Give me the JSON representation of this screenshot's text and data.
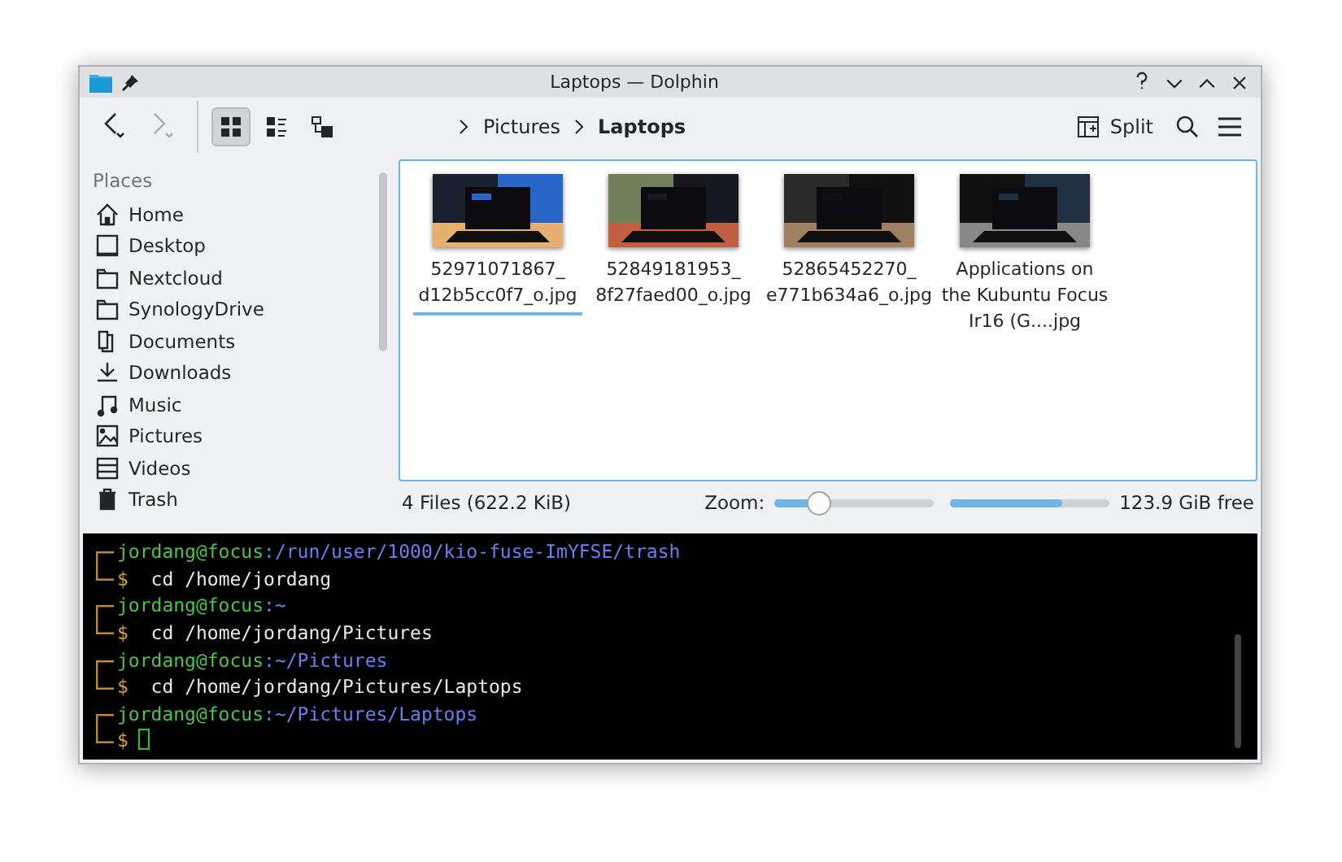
{
  "window": {
    "title": "Laptops — Dolphin"
  },
  "toolbar": {
    "view_modes": [
      {
        "kind": "icons",
        "selected": true
      },
      {
        "kind": "details",
        "selected": false
      },
      {
        "kind": "tree",
        "selected": false
      }
    ],
    "breadcrumb": [
      {
        "label": "Pictures",
        "current": false
      },
      {
        "label": "Laptops",
        "current": true
      }
    ],
    "split_label": "Split"
  },
  "sidebar": {
    "heading": "Places",
    "items": [
      {
        "label": "Home",
        "kind": "home"
      },
      {
        "label": "Desktop",
        "kind": "desktop"
      },
      {
        "label": "Nextcloud",
        "kind": "folder"
      },
      {
        "label": "SynologyDrive",
        "kind": "folder"
      },
      {
        "label": "Documents",
        "kind": "documents"
      },
      {
        "label": "Downloads",
        "kind": "downloads"
      },
      {
        "label": "Music",
        "kind": "music"
      },
      {
        "label": "Pictures",
        "kind": "pictures"
      },
      {
        "label": "Videos",
        "kind": "videos"
      },
      {
        "label": "Trash",
        "kind": "trash"
      }
    ]
  },
  "files": [
    {
      "name": "52971071867_ d12b5cc0f7_o.jpg",
      "focused": true,
      "kind": "picture"
    },
    {
      "name": "52849181953_ 8f27faed00_o.jpg",
      "focused": false,
      "kind": "picture"
    },
    {
      "name": "52865452270_ e771b634a6_o.jpg",
      "focused": false,
      "kind": "picture"
    },
    {
      "name": "Applications on the Kubuntu Focus Ir16 (G....jpg",
      "focused": false,
      "kind": "picture"
    }
  ],
  "status_bar": {
    "summary": "4 Files (622.2 KiB)",
    "zoom_label": "Zoom:",
    "zoom": {
      "level": 0.27
    },
    "space": {
      "level": 0.7
    },
    "free": "123.9 GiB free"
  },
  "terminal": {
    "entries": [
      {
        "user": "jordang@focus",
        "path": ":/run/user/1000/kio-fuse-ImYFSE/trash",
        "command": "cd /home/jordang"
      },
      {
        "user": "jordang@focus",
        "path": ":~",
        "command": "cd /home/jordang/Pictures"
      },
      {
        "user": "jordang@focus",
        "path": ":~/Pictures",
        "command": "cd /home/jordang/Pictures/Laptops"
      },
      {
        "user": "jordang@focus",
        "path": ":~/Pictures/Laptops"
      }
    ],
    "prompt": "$"
  }
}
